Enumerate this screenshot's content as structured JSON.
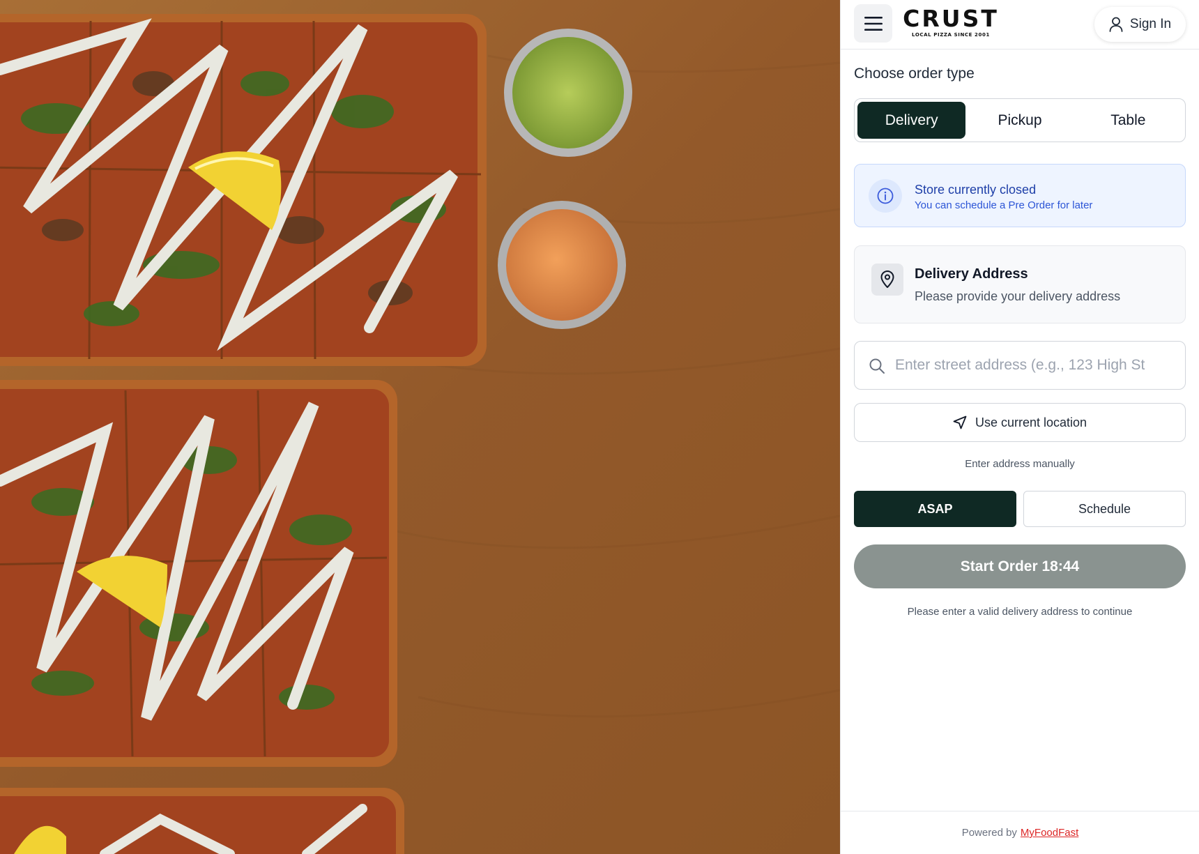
{
  "hero": {
    "description_icon": "pizza-photo"
  },
  "header": {
    "brand": "CRUST",
    "tagline": "LOCAL PIZZA SINCE 2001",
    "sign_in_label": "Sign In"
  },
  "order_type": {
    "title": "Choose order type",
    "tabs": [
      {
        "label": "Delivery",
        "active": true
      },
      {
        "label": "Pickup",
        "active": false
      },
      {
        "label": "Table",
        "active": false
      }
    ]
  },
  "notice": {
    "title": "Store currently closed",
    "subtitle": "You can schedule a Pre Order for later"
  },
  "address": {
    "title": "Delivery Address",
    "subtitle": "Please provide your delivery address",
    "search_placeholder": "Enter street address (e.g., 123 High St",
    "search_value": "",
    "use_location_label": "Use current location",
    "manual_label": "Enter address manually"
  },
  "timing": {
    "asap_label": "ASAP",
    "schedule_label": "Schedule",
    "selected": "ASAP"
  },
  "start": {
    "label": "Start Order 18:44",
    "hint": "Please enter a valid delivery address to continue"
  },
  "footer": {
    "powered_by": "Powered by",
    "link_label": "MyFoodFast"
  },
  "colors": {
    "accent_dark": "#0f2924",
    "notice_text": "#1e3fa8",
    "disabled_button": "#8a9390",
    "footer_link": "#dc2626"
  }
}
